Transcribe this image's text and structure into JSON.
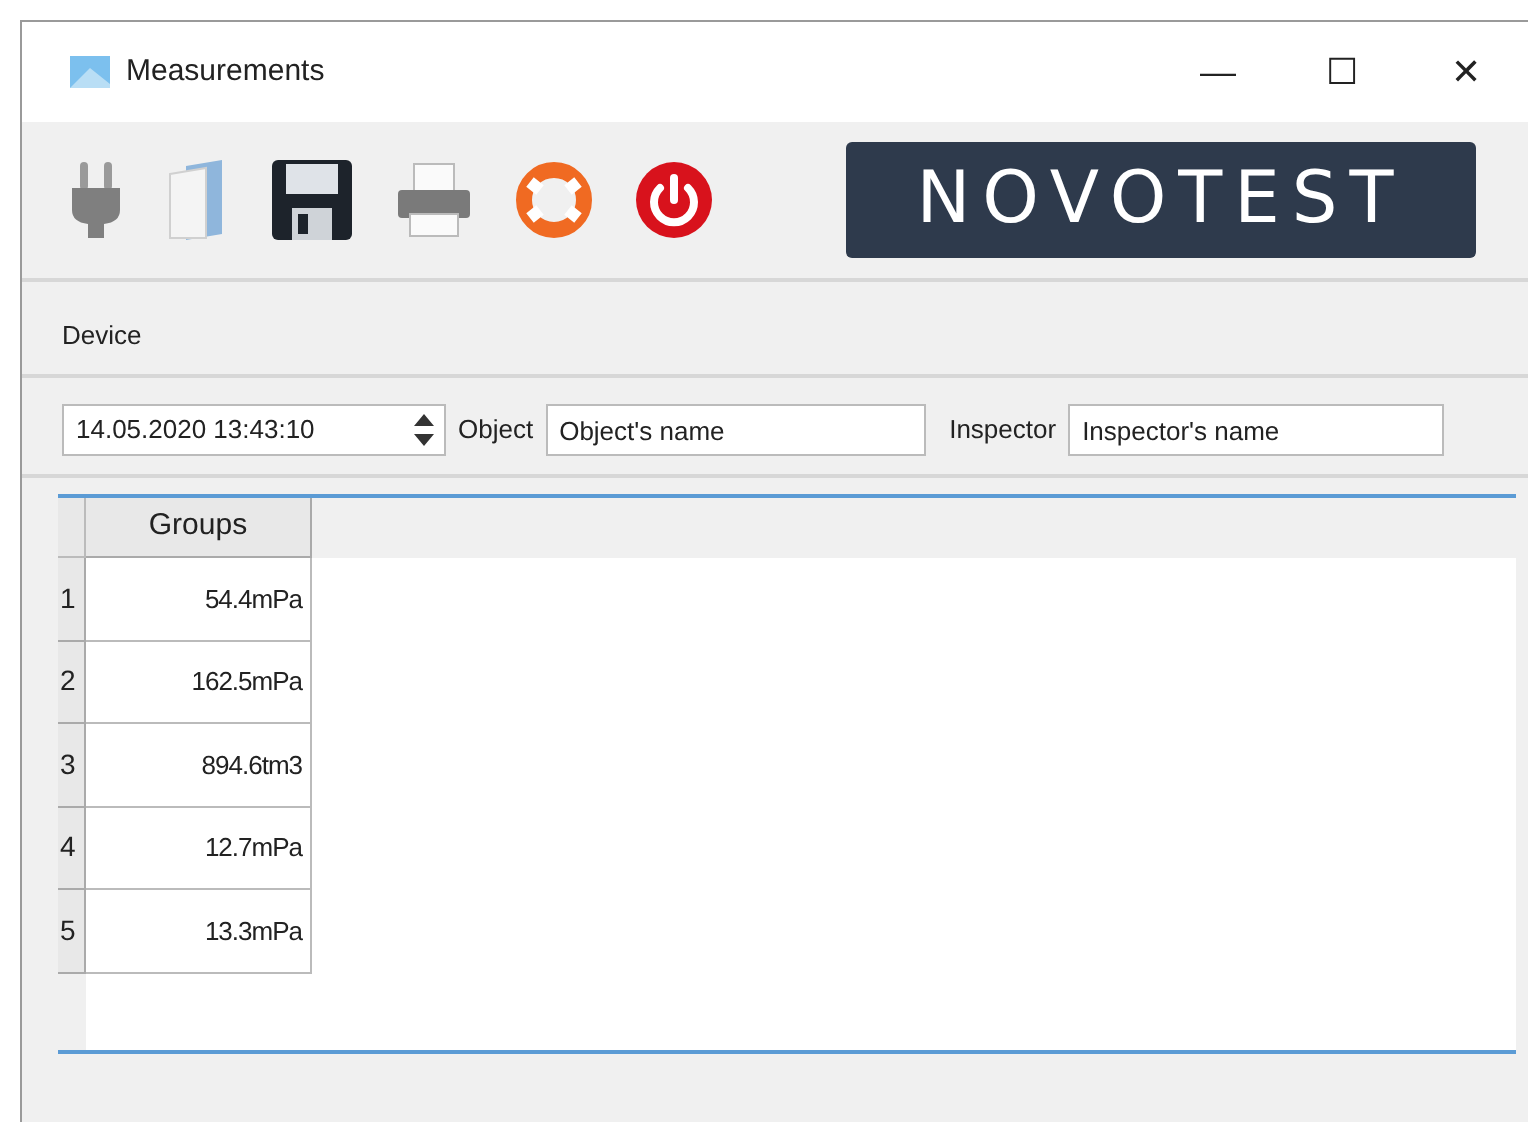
{
  "window": {
    "title": "Measurements",
    "controls": [
      "—",
      "☐",
      "✕"
    ]
  },
  "toolbar": {
    "logo": "NOVOTEST"
  },
  "device_label": "Device",
  "form": {
    "datetime": "14.05.2020 13:43:10",
    "object_label": "Object",
    "object_value": "Object's name",
    "inspector_label": "Inspector",
    "inspector_value": "Inspector's name"
  },
  "table": {
    "columns": [
      "Groups"
    ],
    "rows": [
      {
        "index": "1",
        "value": "54.4mPa"
      },
      {
        "index": "2",
        "value": "162.5mPa"
      },
      {
        "index": "3",
        "value": "894.6tm3"
      },
      {
        "index": "4",
        "value": "12.7mPa"
      },
      {
        "index": "5",
        "value": "13.3mPa"
      }
    ]
  }
}
